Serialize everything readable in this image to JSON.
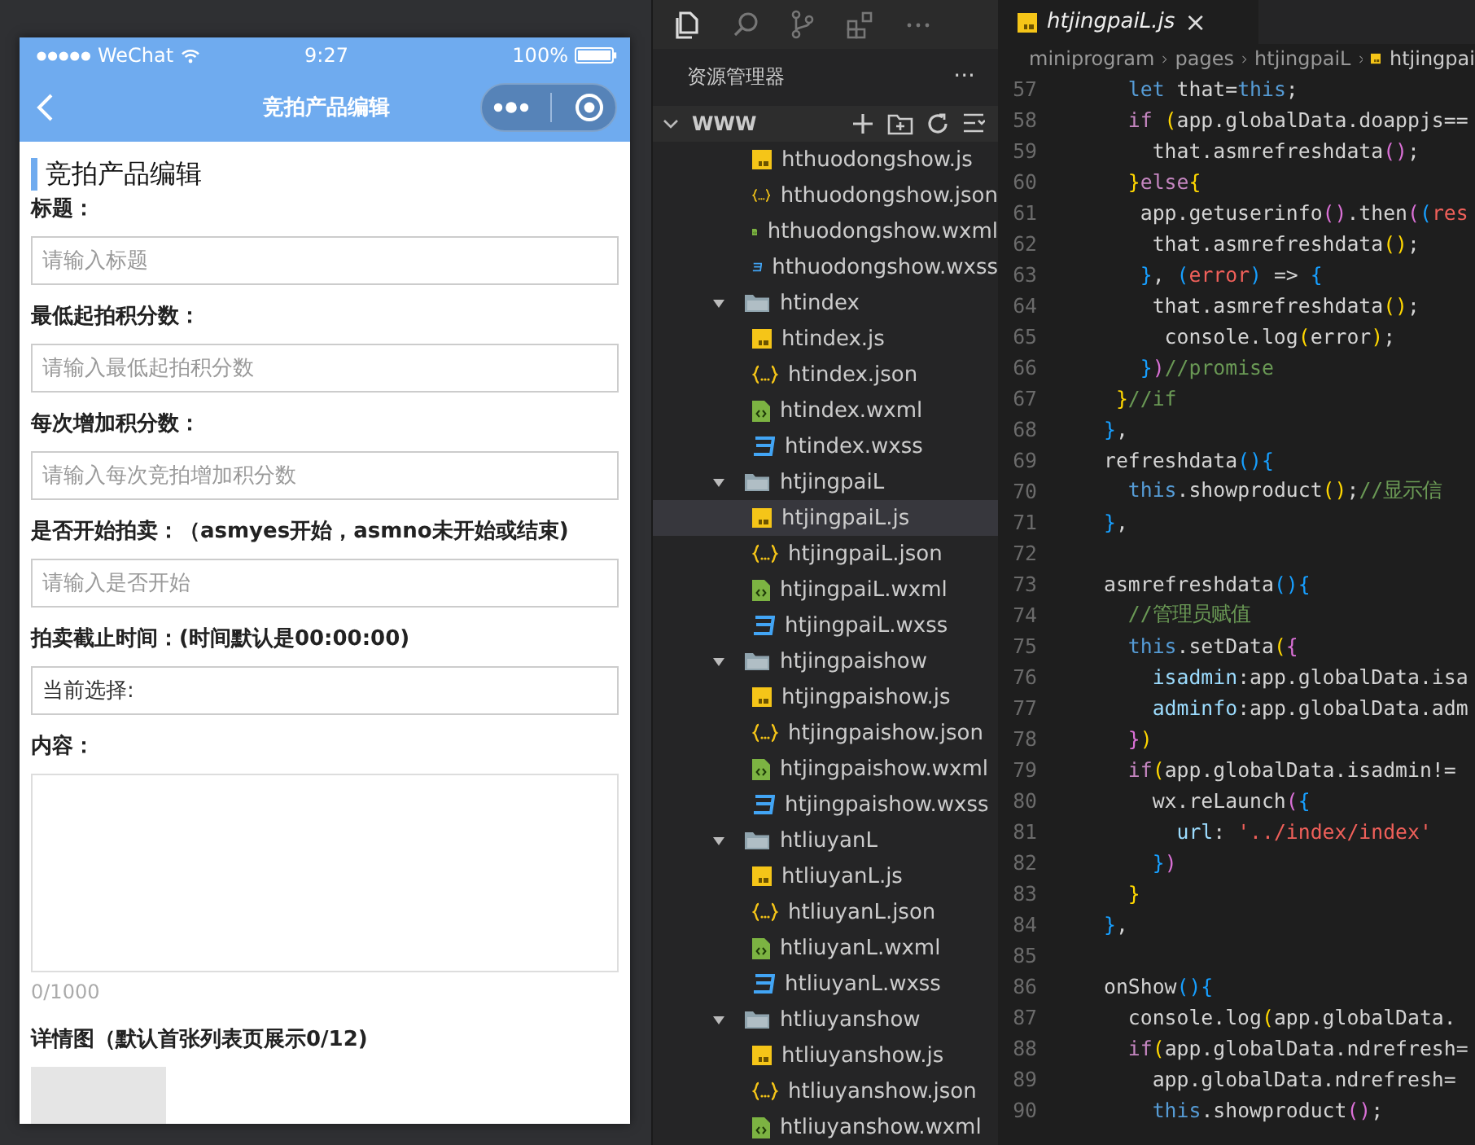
{
  "phone": {
    "status_bar": {
      "carrier": "WeChat",
      "time": "9:27",
      "battery": "100%"
    },
    "nav_bar": {
      "title": "竞拍产品编辑"
    },
    "section_title": "竞拍产品编辑",
    "fields": [
      {
        "kind": "input",
        "label": "标题：",
        "placeholder": "请输入标题"
      },
      {
        "kind": "input",
        "label": "最低起拍积分数：",
        "placeholder": "请输入最低起拍积分数"
      },
      {
        "kind": "input",
        "label": "每次增加积分数：",
        "placeholder": "请输入每次竞拍增加积分数"
      },
      {
        "kind": "input",
        "label": "是否开始拍卖：（asmyes开始，asmno未开始或结束)",
        "placeholder": "请输入是否开始"
      },
      {
        "kind": "picker",
        "label": "拍卖截止时间：(时间默认是00:00:00)",
        "value": "当前选择:"
      },
      {
        "kind": "textarea",
        "label": "内容：",
        "counter": "0/1000"
      },
      {
        "kind": "upload",
        "label": "详情图（默认首张列表页展示0/12)"
      }
    ]
  },
  "explorer": {
    "title": "资源管理器",
    "more": "···",
    "root": "WWW",
    "tree": [
      {
        "kind": "js",
        "label": "hthuodongshow.js",
        "selected": false
      },
      {
        "kind": "json",
        "label": "hthuodongshow.json",
        "selected": false
      },
      {
        "kind": "wxml",
        "label": "hthuodongshow.wxml",
        "selected": false
      },
      {
        "kind": "wxss",
        "label": "hthuodongshow.wxss",
        "selected": false
      },
      {
        "kind": "folder",
        "label": "htindex",
        "expanded": true,
        "children": [
          {
            "kind": "js",
            "label": "htindex.js",
            "selected": false
          },
          {
            "kind": "json",
            "label": "htindex.json",
            "selected": false
          },
          {
            "kind": "wxml",
            "label": "htindex.wxml",
            "selected": false
          },
          {
            "kind": "wxss",
            "label": "htindex.wxss",
            "selected": false
          }
        ]
      },
      {
        "kind": "folder",
        "label": "htjingpaiL",
        "expanded": true,
        "children": [
          {
            "kind": "js",
            "label": "htjingpaiL.js",
            "selected": true
          },
          {
            "kind": "json",
            "label": "htjingpaiL.json",
            "selected": false
          },
          {
            "kind": "wxml",
            "label": "htjingpaiL.wxml",
            "selected": false
          },
          {
            "kind": "wxss",
            "label": "htjingpaiL.wxss",
            "selected": false
          }
        ]
      },
      {
        "kind": "folder",
        "label": "htjingpaishow",
        "expanded": true,
        "children": [
          {
            "kind": "js",
            "label": "htjingpaishow.js",
            "selected": false
          },
          {
            "kind": "json",
            "label": "htjingpaishow.json",
            "selected": false
          },
          {
            "kind": "wxml",
            "label": "htjingpaishow.wxml",
            "selected": false
          },
          {
            "kind": "wxss",
            "label": "htjingpaishow.wxss",
            "selected": false
          }
        ]
      },
      {
        "kind": "folder",
        "label": "htliuyanL",
        "expanded": true,
        "children": [
          {
            "kind": "js",
            "label": "htliuyanL.js",
            "selected": false
          },
          {
            "kind": "json",
            "label": "htliuyanL.json",
            "selected": false
          },
          {
            "kind": "wxml",
            "label": "htliuyanL.wxml",
            "selected": false
          },
          {
            "kind": "wxss",
            "label": "htliuyanL.wxss",
            "selected": false
          }
        ]
      },
      {
        "kind": "folder",
        "label": "htliuyanshow",
        "expanded": true,
        "children": [
          {
            "kind": "js",
            "label": "htliuyanshow.js",
            "selected": false
          },
          {
            "kind": "json",
            "label": "htliuyanshow.json",
            "selected": false
          },
          {
            "kind": "wxml",
            "label": "htliuyanshow.wxml",
            "selected": false
          }
        ]
      }
    ]
  },
  "editor": {
    "tab": {
      "label": "htjingpaiL.js",
      "close": "×"
    },
    "breadcrumb": [
      "miniprogram",
      "pages",
      "htjingpaiL",
      "htjingpai"
    ],
    "lines": [
      {
        "n": "57",
        "tokens": [
          {
            "t": "  let",
            "color": "#569cd6"
          },
          {
            "t": " that=",
            "color": "#d4d4d4"
          },
          {
            "t": "this",
            "color": "#569cd6"
          },
          {
            "t": ";",
            "color": "#d4d4d4"
          }
        ]
      },
      {
        "n": "58",
        "tokens": [
          {
            "t": "  if",
            "color": "#c586c0"
          },
          {
            "t": " (",
            "color": "#ffd700"
          },
          {
            "t": "app.globalData.doappjs==",
            "color": "#d4d4d4"
          }
        ]
      },
      {
        "n": "59",
        "tokens": [
          {
            "t": "    that.asmrefreshdata",
            "color": "#d4d4d4"
          },
          {
            "t": "()",
            "color": "#da70d6"
          },
          {
            "t": ";",
            "color": "#d4d4d4"
          }
        ]
      },
      {
        "n": "60",
        "tokens": [
          {
            "t": "  }",
            "color": "#ffd700"
          },
          {
            "t": "else",
            "color": "#c586c0"
          },
          {
            "t": "{",
            "color": "#ffd700"
          }
        ]
      },
      {
        "n": "61",
        "tokens": [
          {
            "t": "   app.getuserinfo",
            "color": "#d4d4d4"
          },
          {
            "t": "()",
            "color": "#da70d6"
          },
          {
            "t": ".then",
            "color": "#d4d4d4"
          },
          {
            "t": "(",
            "color": "#da70d6"
          },
          {
            "t": "(",
            "color": "#179fff"
          },
          {
            "t": "res",
            "color": "#f0605a"
          }
        ]
      },
      {
        "n": "62",
        "tokens": [
          {
            "t": "    that.asmrefreshdata",
            "color": "#d4d4d4"
          },
          {
            "t": "()",
            "color": "#ffd700"
          },
          {
            "t": ";",
            "color": "#d4d4d4"
          }
        ]
      },
      {
        "n": "63",
        "tokens": [
          {
            "t": "   }",
            "color": "#179fff"
          },
          {
            "t": ",",
            "color": "#d4d4d4"
          },
          {
            "t": " (",
            "color": "#179fff"
          },
          {
            "t": "error",
            "color": "#f0605a"
          },
          {
            "t": ")",
            "color": "#179fff"
          },
          {
            "t": " =>",
            "color": "#d4d4d4"
          },
          {
            "t": " {",
            "color": "#179fff"
          }
        ]
      },
      {
        "n": "64",
        "tokens": [
          {
            "t": "    that.asmrefreshdata",
            "color": "#d4d4d4"
          },
          {
            "t": "()",
            "color": "#ffd700"
          },
          {
            "t": ";",
            "color": "#d4d4d4"
          }
        ]
      },
      {
        "n": "65",
        "tokens": [
          {
            "t": "     console.log",
            "color": "#d4d4d4"
          },
          {
            "t": "(",
            "color": "#ffd700"
          },
          {
            "t": "error",
            "color": "#d4d4d4"
          },
          {
            "t": ")",
            "color": "#ffd700"
          },
          {
            "t": ";",
            "color": "#d4d4d4"
          }
        ]
      },
      {
        "n": "66",
        "tokens": [
          {
            "t": "   }",
            "color": "#179fff"
          },
          {
            "t": ")",
            "color": "#da70d6"
          },
          {
            "t": "//promise",
            "color": "#6a9955"
          }
        ]
      },
      {
        "n": "67",
        "tokens": [
          {
            "t": " }",
            "color": "#ffd700"
          },
          {
            "t": "//if",
            "color": "#6a9955"
          }
        ]
      },
      {
        "n": "68",
        "tokens": [
          {
            "t": "}",
            "color": "#179fff"
          },
          {
            "t": ",",
            "color": "#d4d4d4"
          }
        ]
      },
      {
        "n": "69",
        "tokens": [
          {
            "t": "refreshdata",
            "color": "#d4d4d4"
          },
          {
            "t": "(){",
            "color": "#179fff"
          }
        ]
      },
      {
        "n": "70",
        "tokens": [
          {
            "t": "  this",
            "color": "#569cd6"
          },
          {
            "t": ".showproduct",
            "color": "#d4d4d4"
          },
          {
            "t": "()",
            "color": "#ffd700"
          },
          {
            "t": ";",
            "color": "#d4d4d4"
          },
          {
            "t": "//显示信",
            "color": "#6a9955"
          }
        ]
      },
      {
        "n": "71",
        "tokens": [
          {
            "t": "}",
            "color": "#179fff"
          },
          {
            "t": ",",
            "color": "#d4d4d4"
          }
        ]
      },
      {
        "n": "72"
      },
      {
        "n": "73",
        "tokens": [
          {
            "t": "asmrefreshdata",
            "color": "#d4d4d4"
          },
          {
            "t": "(){",
            "color": "#179fff"
          }
        ]
      },
      {
        "n": "74",
        "tokens": [
          {
            "t": "  //管理员赋值",
            "color": "#6a9955"
          }
        ]
      },
      {
        "n": "75",
        "tokens": [
          {
            "t": "  this",
            "color": "#569cd6"
          },
          {
            "t": ".setData",
            "color": "#d4d4d4"
          },
          {
            "t": "(",
            "color": "#ffd700"
          },
          {
            "t": "{",
            "color": "#da70d6"
          }
        ]
      },
      {
        "n": "76",
        "tokens": [
          {
            "t": "    isadmin",
            "color": "#9cdcfe"
          },
          {
            "t": ":app.globalData.isa",
            "color": "#d4d4d4"
          }
        ]
      },
      {
        "n": "77",
        "tokens": [
          {
            "t": "    adminfo",
            "color": "#9cdcfe"
          },
          {
            "t": ":app.globalData.adm",
            "color": "#d4d4d4"
          }
        ]
      },
      {
        "n": "78",
        "tokens": [
          {
            "t": "  }",
            "color": "#da70d6"
          },
          {
            "t": ")",
            "color": "#ffd700"
          }
        ]
      },
      {
        "n": "79",
        "tokens": [
          {
            "t": "  if",
            "color": "#c586c0"
          },
          {
            "t": "(",
            "color": "#ffd700"
          },
          {
            "t": "app.globalData.isadmin!=",
            "color": "#d4d4d4"
          }
        ]
      },
      {
        "n": "80",
        "tokens": [
          {
            "t": "    wx.reLaunch",
            "color": "#d4d4d4"
          },
          {
            "t": "(",
            "color": "#da70d6"
          },
          {
            "t": "{",
            "color": "#179fff"
          }
        ]
      },
      {
        "n": "81",
        "tokens": [
          {
            "t": "      url",
            "color": "#9cdcfe"
          },
          {
            "t": ":",
            "color": "#d4d4d4"
          },
          {
            "t": " '../index/index'",
            "color": "#f0605a"
          }
        ]
      },
      {
        "n": "82",
        "tokens": [
          {
            "t": "    }",
            "color": "#179fff"
          },
          {
            "t": ")",
            "color": "#da70d6"
          }
        ]
      },
      {
        "n": "83",
        "tokens": [
          {
            "t": "  }",
            "color": "#ffd700"
          }
        ]
      },
      {
        "n": "84",
        "tokens": [
          {
            "t": "}",
            "color": "#179fff"
          },
          {
            "t": ",",
            "color": "#d4d4d4"
          }
        ]
      },
      {
        "n": "85"
      },
      {
        "n": "86",
        "tokens": [
          {
            "t": "onShow",
            "color": "#d4d4d4"
          },
          {
            "t": "(){",
            "color": "#179fff"
          }
        ]
      },
      {
        "n": "87",
        "tokens": [
          {
            "t": "  console.log",
            "color": "#d4d4d4"
          },
          {
            "t": "(",
            "color": "#ffd700"
          },
          {
            "t": "app.globalData.",
            "color": "#d4d4d4"
          }
        ]
      },
      {
        "n": "88",
        "tokens": [
          {
            "t": "  if",
            "color": "#c586c0"
          },
          {
            "t": "(",
            "color": "#ffd700"
          },
          {
            "t": "app.globalData.ndrefresh=",
            "color": "#d4d4d4"
          }
        ]
      },
      {
        "n": "89",
        "tokens": [
          {
            "t": "    app.globalData.ndrefresh=",
            "color": "#d4d4d4"
          }
        ]
      },
      {
        "n": "90",
        "tokens": [
          {
            "t": "    this",
            "color": "#569cd6"
          },
          {
            "t": ".showproduct",
            "color": "#d4d4d4"
          },
          {
            "t": "()",
            "color": "#da70d6"
          },
          {
            "t": ";",
            "color": "#d4d4d4"
          }
        ]
      }
    ]
  }
}
